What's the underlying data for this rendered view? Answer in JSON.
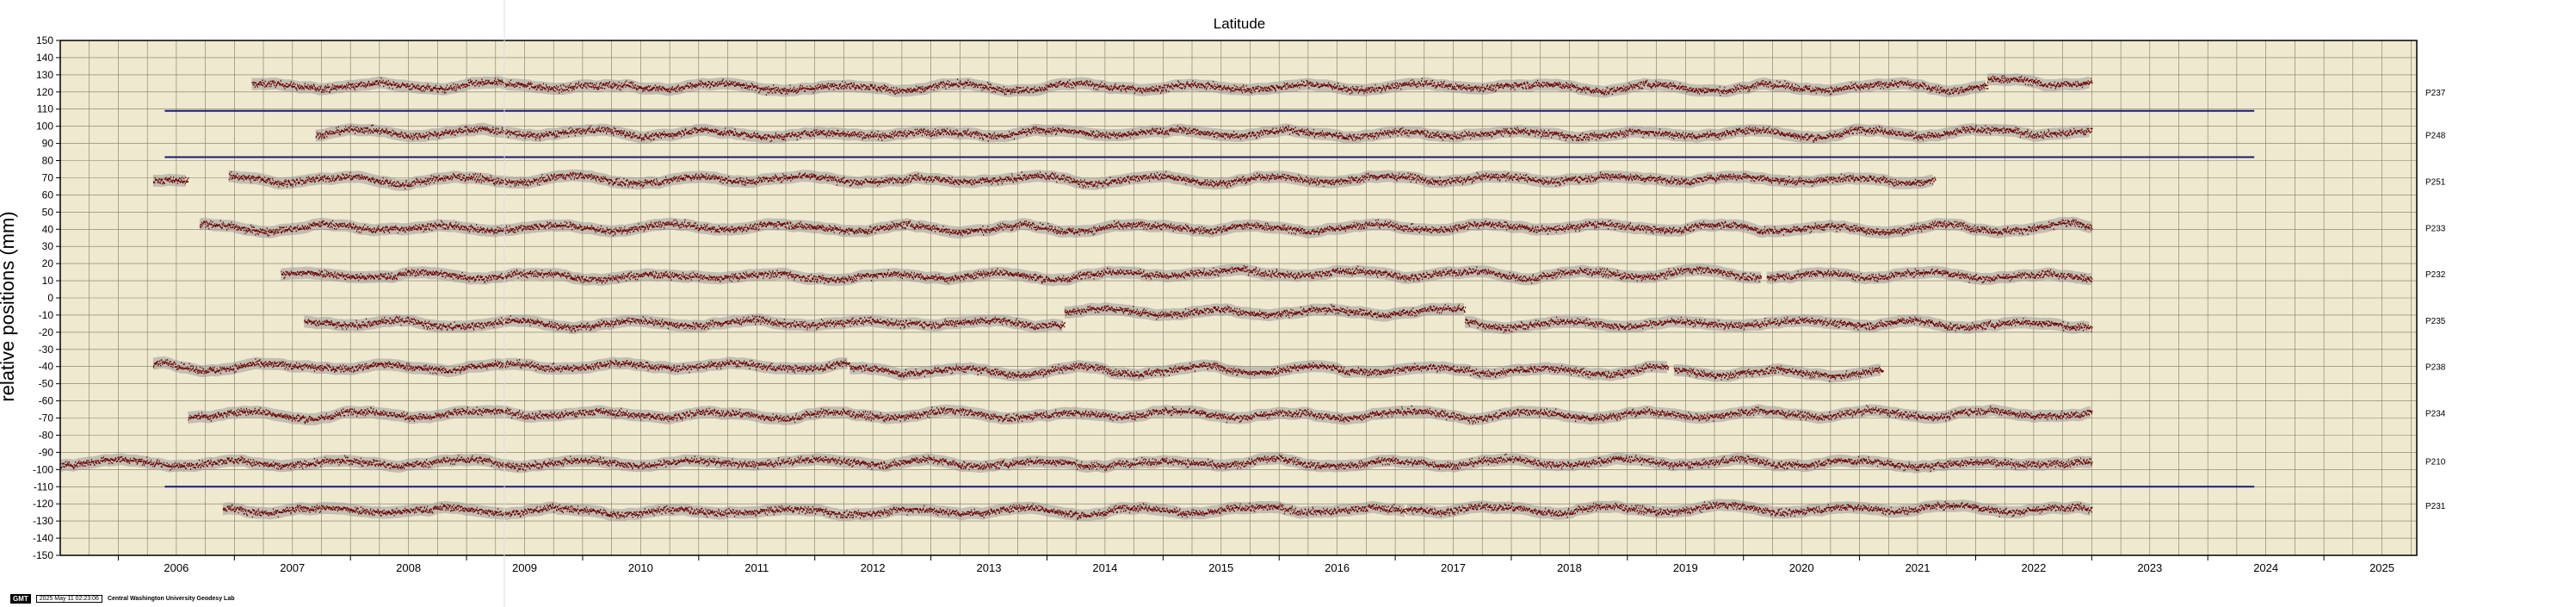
{
  "chart_data": {
    "type": "scatter",
    "title": "Latitude",
    "ylabel": "relative positions (mm)",
    "xlabel": "",
    "xlim": [
      2005.5,
      2025.8
    ],
    "ylim": [
      -150,
      150
    ],
    "x_ticks": [
      "2006",
      "2007",
      "2008",
      "2009",
      "2010",
      "2011",
      "2012",
      "2013",
      "2014",
      "2015",
      "2016",
      "2017",
      "2018",
      "2019",
      "2020",
      "2021",
      "2022",
      "2023",
      "2024",
      "2025"
    ],
    "y_ticks": [
      "150",
      "140",
      "130",
      "120",
      "110",
      "100",
      "90",
      "80",
      "70",
      "60",
      "50",
      "40",
      "30",
      "20",
      "10",
      "0",
      "-10",
      "-20",
      "-30",
      "-40",
      "-50",
      "-60",
      "-70",
      "-80",
      "-90",
      "-100",
      "-110",
      "-120",
      "-130",
      "-140",
      "-150"
    ],
    "grid": true,
    "colors": {
      "background": "#efe9cf",
      "points": "#6b0000",
      "band": "#9a9a9a",
      "separator": "#1a1a7a",
      "grid": "#7f7a66"
    },
    "series": [
      {
        "name": "P237",
        "label_y": 120,
        "segments": [
          {
            "start": 2007.15,
            "end": 2022.1,
            "level": 123
          },
          {
            "start": 2022.1,
            "end": 2023.0,
            "level": 126
          }
        ]
      },
      {
        "name": "P248",
        "label_y": 95,
        "segments": [
          {
            "start": 2007.7,
            "end": 2023.0,
            "level": 96
          }
        ]
      },
      {
        "name": "P251",
        "label_y": 68,
        "segments": [
          {
            "start": 2006.3,
            "end": 2006.6,
            "level": 70
          },
          {
            "start": 2006.95,
            "end": 2021.65,
            "level": 69
          }
        ]
      },
      {
        "name": "P233",
        "label_y": 41,
        "segments": [
          {
            "start": 2006.7,
            "end": 2023.0,
            "level": 41
          }
        ]
      },
      {
        "name": "P232",
        "label_y": 14,
        "segments": [
          {
            "start": 2007.4,
            "end": 2014.4,
            "level": 13
          },
          {
            "start": 2014.4,
            "end": 2020.15,
            "level": 14
          },
          {
            "start": 2020.2,
            "end": 2023.0,
            "level": 13
          }
        ]
      },
      {
        "name": "P235",
        "label_y": -13,
        "segments": [
          {
            "start": 2007.6,
            "end": 2014.15,
            "level": -15
          },
          {
            "start": 2014.15,
            "end": 2017.6,
            "level": -8
          },
          {
            "start": 2017.6,
            "end": 2023.0,
            "level": -15
          }
        ]
      },
      {
        "name": "P238",
        "label_y": -40,
        "segments": [
          {
            "start": 2006.3,
            "end": 2012.3,
            "level": -40
          },
          {
            "start": 2012.3,
            "end": 2019.35,
            "level": -42
          },
          {
            "start": 2019.4,
            "end": 2021.2,
            "level": -43
          }
        ]
      },
      {
        "name": "P234",
        "label_y": -67,
        "segments": [
          {
            "start": 2006.6,
            "end": 2023.0,
            "level": -68
          }
        ]
      },
      {
        "name": "P210",
        "label_y": -95,
        "segments": [
          {
            "start": 2005.5,
            "end": 2023.0,
            "level": -96
          }
        ]
      },
      {
        "name": "P231",
        "label_y": -121,
        "segments": [
          {
            "start": 2006.9,
            "end": 2017.1,
            "level": -124
          },
          {
            "start": 2017.1,
            "end": 2023.0,
            "level": -123
          }
        ]
      }
    ],
    "separators": [
      {
        "y": 109,
        "start": 2006.4,
        "end": 2024.4
      },
      {
        "y": 82,
        "start": 2006.4,
        "end": 2024.4
      },
      {
        "y": -110,
        "start": 2006.4,
        "end": 2024.4
      }
    ]
  },
  "footer": {
    "logo": "GMT",
    "timestamp": "2025 May 11 02:23:06",
    "lab": "Central Washington University Geodesy Lab"
  }
}
